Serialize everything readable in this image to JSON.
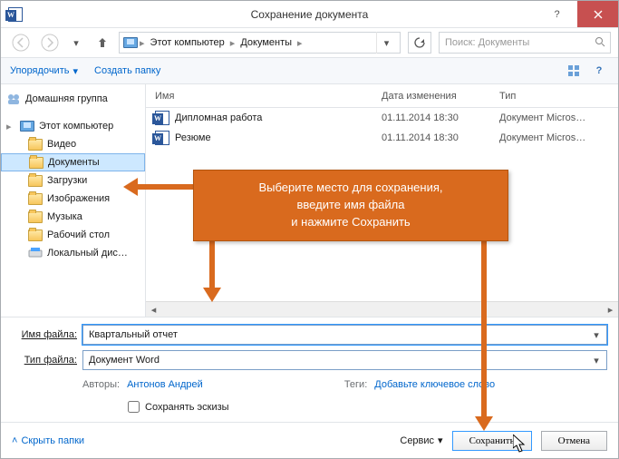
{
  "window": {
    "title": "Сохранение документа"
  },
  "breadcrumb": {
    "root_icon": "pc",
    "segments": [
      "Этот компьютер",
      "Документы"
    ]
  },
  "search": {
    "placeholder": "Поиск: Документы"
  },
  "toolbar": {
    "organize": "Упорядочить",
    "new_folder": "Создать папку"
  },
  "sidebar": {
    "homegroup": "Домашняя группа",
    "this_pc": "Этот компьютер",
    "items": [
      {
        "label": "Видео",
        "icon": "folder"
      },
      {
        "label": "Документы",
        "icon": "folder",
        "selected": true
      },
      {
        "label": "Загрузки",
        "icon": "folder"
      },
      {
        "label": "Изображения",
        "icon": "folder"
      },
      {
        "label": "Музыка",
        "icon": "folder"
      },
      {
        "label": "Рабочий стол",
        "icon": "folder"
      },
      {
        "label": "Локальный дис…",
        "icon": "disk"
      }
    ]
  },
  "filelist": {
    "columns": {
      "name": "Имя",
      "date": "Дата изменения",
      "type": "Тип"
    },
    "rows": [
      {
        "name": "Дипломная работа",
        "date": "01.11.2014 18:30",
        "type": "Документ Micros…"
      },
      {
        "name": "Резюме",
        "date": "01.11.2014 18:30",
        "type": "Документ Micros…"
      }
    ]
  },
  "form": {
    "filename_label": "Имя файла:",
    "filename_value": "Квартальный отчет",
    "filetype_label": "Тип файла:",
    "filetype_value": "Документ Word",
    "authors_label": "Авторы:",
    "authors_value": "Антонов Андрей",
    "tags_label": "Теги:",
    "tags_value": "Добавьте ключевое слово",
    "save_thumb": "Сохранять эскизы"
  },
  "buttons": {
    "hide_folders": "Скрыть папки",
    "tools": "Сервис",
    "save": "Сохранить",
    "cancel": "Отмена"
  },
  "callout": {
    "line1": "Выберите место для сохранения,",
    "line2": "введите имя файла",
    "line3": "и нажмите Сохранить"
  }
}
